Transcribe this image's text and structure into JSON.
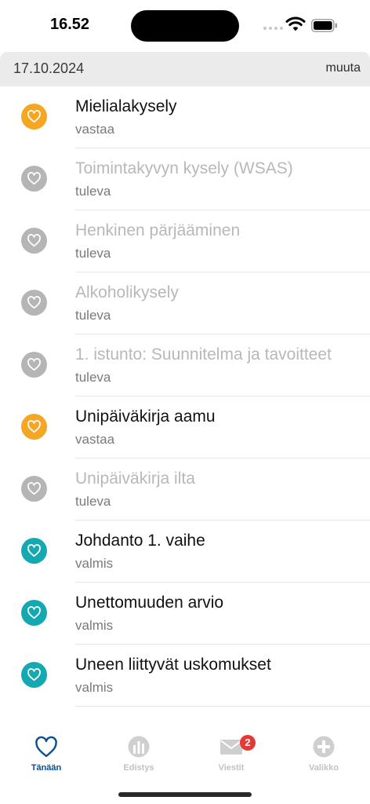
{
  "status_bar": {
    "time": "16.52"
  },
  "header": {
    "date": "17.10.2024",
    "change_label": "muuta"
  },
  "tasks": [
    {
      "title": "Mielialakysely",
      "status": "vastaa",
      "state": "open"
    },
    {
      "title": "Toimintakyvyn kysely (WSAS)",
      "status": "tuleva",
      "state": "upcoming"
    },
    {
      "title": "Henkinen pärjääminen",
      "status": "tuleva",
      "state": "upcoming"
    },
    {
      "title": "Alkoholikysely",
      "status": "tuleva",
      "state": "upcoming"
    },
    {
      "title": "1. istunto: Suunnitelma ja tavoitteet",
      "status": "tuleva",
      "state": "upcoming"
    },
    {
      "title": "Unipäiväkirja aamu",
      "status": "vastaa",
      "state": "open"
    },
    {
      "title": "Unipäiväkirja ilta",
      "status": "tuleva",
      "state": "upcoming"
    },
    {
      "title": "Johdanto 1. vaihe",
      "status": "valmis",
      "state": "done"
    },
    {
      "title": "Unettomuuden arvio",
      "status": "valmis",
      "state": "done"
    },
    {
      "title": "Uneen liittyvät uskomukset",
      "status": "valmis",
      "state": "done"
    }
  ],
  "colors": {
    "open": "#f5a623",
    "upcoming": "#b5b5b5",
    "done": "#14a8b3",
    "active_tab": "#0d4f8b"
  },
  "tab_bar": {
    "tabs": [
      {
        "label": "Tänään",
        "icon": "heart-icon",
        "active": true
      },
      {
        "label": "Edistys",
        "icon": "chart-icon",
        "active": false
      },
      {
        "label": "Viestit",
        "icon": "mail-icon",
        "active": false,
        "badge": "2"
      },
      {
        "label": "Valikko",
        "icon": "plus-circle-icon",
        "active": false
      }
    ]
  }
}
